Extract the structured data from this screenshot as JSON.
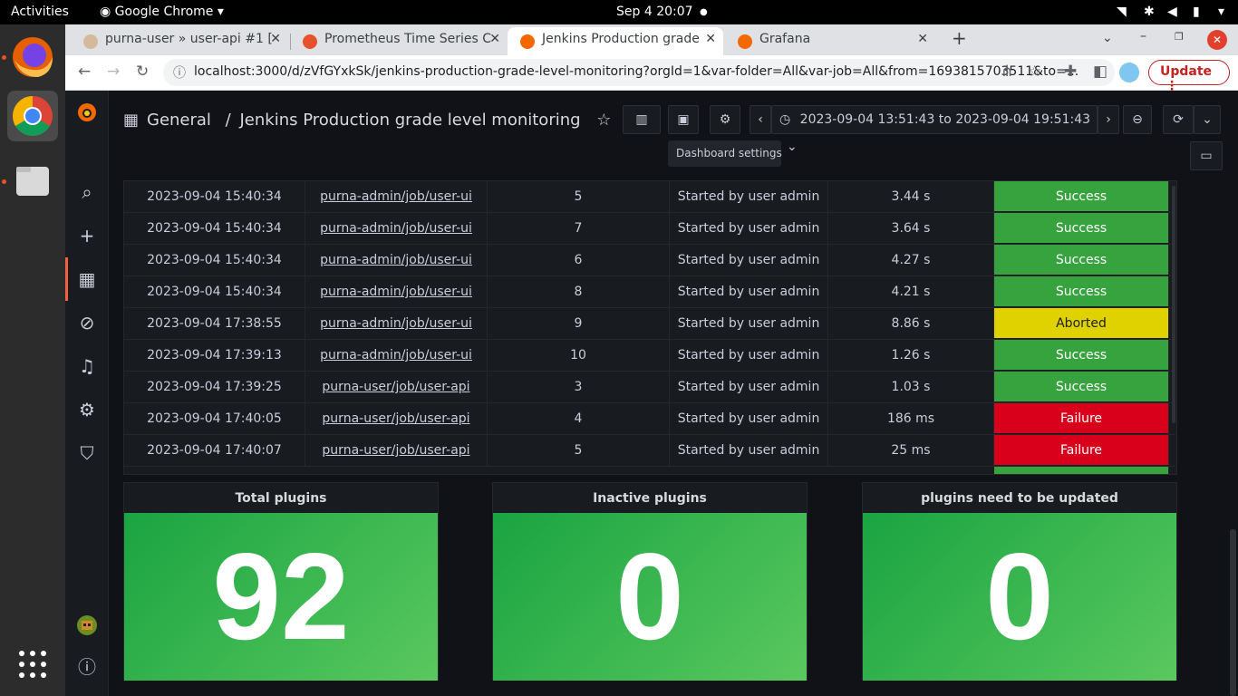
{
  "os": {
    "activities": "Activities",
    "app_menu": "Google Chrome",
    "clock": "Sep 4  20:07"
  },
  "browser": {
    "tabs": [
      {
        "title": "purna-user » user-api #1 [",
        "icon": "jenkins-icon"
      },
      {
        "title": "Prometheus Time Series C",
        "icon": "prometheus-icon"
      },
      {
        "title": "Jenkins Production grade",
        "icon": "grafana-icon"
      },
      {
        "title": "Grafana",
        "icon": "grafana-icon"
      }
    ],
    "url": "localhost:3000/d/zVfGYxkSk/jenkins-production-grade-level-monitoring?orgId=1&var-folder=All&var-job=All&from=1693815703511&to=...",
    "url_host": "localhost",
    "update_label": "Update"
  },
  "grafana": {
    "breadcrumb_folder": "General",
    "breadcrumb_sep": "/",
    "dashboard_title": "Jenkins Production grade level monitoring",
    "time_range": "2023-09-04 13:51:43 to 2023-09-04 19:51:43",
    "tooltip": "Dashboard settings"
  },
  "table": {
    "rows": [
      {
        "time": "2023-09-04 15:40:34",
        "job": "purna-admin/job/user-ui",
        "build": "5",
        "cause": "Started by user admin",
        "duration": "3.44 s",
        "status": "Success"
      },
      {
        "time": "2023-09-04 15:40:34",
        "job": "purna-admin/job/user-ui",
        "build": "7",
        "cause": "Started by user admin",
        "duration": "3.64 s",
        "status": "Success"
      },
      {
        "time": "2023-09-04 15:40:34",
        "job": "purna-admin/job/user-ui",
        "build": "6",
        "cause": "Started by user admin",
        "duration": "4.27 s",
        "status": "Success"
      },
      {
        "time": "2023-09-04 15:40:34",
        "job": "purna-admin/job/user-ui",
        "build": "8",
        "cause": "Started by user admin",
        "duration": "4.21 s",
        "status": "Success"
      },
      {
        "time": "2023-09-04 17:38:55",
        "job": "purna-admin/job/user-ui",
        "build": "9",
        "cause": "Started by user admin",
        "duration": "8.86 s",
        "status": "Aborted"
      },
      {
        "time": "2023-09-04 17:39:13",
        "job": "purna-admin/job/user-ui",
        "build": "10",
        "cause": "Started by user admin",
        "duration": "1.26 s",
        "status": "Success"
      },
      {
        "time": "2023-09-04 17:39:25",
        "job": "purna-user/job/user-api",
        "build": "3",
        "cause": "Started by user admin",
        "duration": "1.03 s",
        "status": "Success"
      },
      {
        "time": "2023-09-04 17:40:05",
        "job": "purna-user/job/user-api",
        "build": "4",
        "cause": "Started by user admin",
        "duration": "186 ms",
        "status": "Failure"
      },
      {
        "time": "2023-09-04 17:40:07",
        "job": "purna-user/job/user-api",
        "build": "5",
        "cause": "Started by user admin",
        "duration": "25 ms",
        "status": "Failure"
      }
    ],
    "status_colors": {
      "Success": "#37a33e",
      "Aborted": "#e0d200",
      "Failure": "#d8001b"
    }
  },
  "stats": [
    {
      "title": "Total plugins",
      "value": "92"
    },
    {
      "title": "Inactive plugins",
      "value": "0"
    },
    {
      "title": "plugins need to be updated",
      "value": "0"
    }
  ]
}
